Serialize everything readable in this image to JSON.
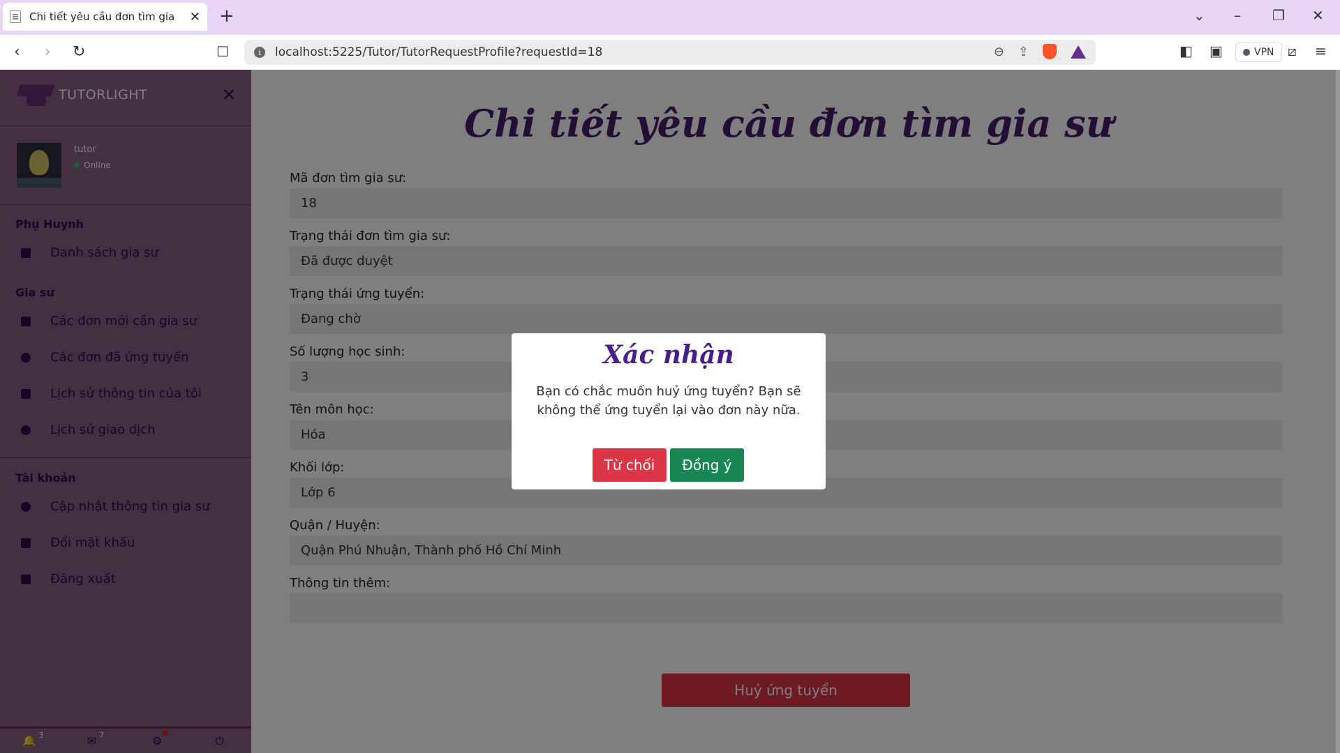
{
  "browser": {
    "tab_title": "Chi tiết yêu cầu đơn tìm gia sư",
    "url": "localhost:5225/Tutor/TutorRequestProfile?requestId=18",
    "vpn_label": "VPN"
  },
  "sidebar": {
    "brand": "TUTORLIGHT",
    "user_name": "tutor",
    "user_status": "Online",
    "sections": [
      {
        "title": "Phụ Huynh",
        "items": [
          "Danh sách gia sư"
        ]
      },
      {
        "title": "Gia sư",
        "items": [
          "Các đơn mới cần gia sư",
          "Các đơn đã ứng tuyển",
          "Lịch sử thông tin của tôi",
          "Lịch sử giao dịch"
        ]
      },
      {
        "title": "Tài khoản",
        "items": [
          "Cập nhật thông tin gia sư",
          "Đổi mật khẩu",
          "Đăng xuất"
        ]
      }
    ],
    "footer": {
      "notifications_count": "3",
      "messages_count": "7"
    }
  },
  "main": {
    "title": "Chi tiết yêu cầu đơn tìm gia sư",
    "fields": [
      {
        "label": "Mã đơn tìm gia sư:",
        "value": "18"
      },
      {
        "label": "Trạng thái đơn tìm gia sư:",
        "value": "Đã được duyệt"
      },
      {
        "label": "Trạng thái ứng tuyển:",
        "value": "Đang chờ"
      },
      {
        "label": "Số lượng học sinh:",
        "value": "3"
      },
      {
        "label": "Tên môn học:",
        "value": "Hóa"
      },
      {
        "label": "Khối lớp:",
        "value": "Lớp 6"
      },
      {
        "label": "Quận / Huyện:",
        "value": "Quận Phú Nhuận, Thành phố Hồ Chí Minh"
      },
      {
        "label": "Thông tin thêm:",
        "value": ""
      }
    ],
    "cancel_button": "Huỷ ứng tuyển"
  },
  "modal": {
    "title": "Xác nhận",
    "message": "Bạn có chắc muốn huỷ ứng tuyển? Bạn sẽ không thể ứng tuyển lại vào đơn này nữa.",
    "reject_label": "Từ chối",
    "accept_label": "Đồng ý"
  },
  "colors": {
    "accent": "#4b1d6b",
    "sidebar": "#8b5f86",
    "danger": "#dc3545",
    "success": "#198754"
  }
}
